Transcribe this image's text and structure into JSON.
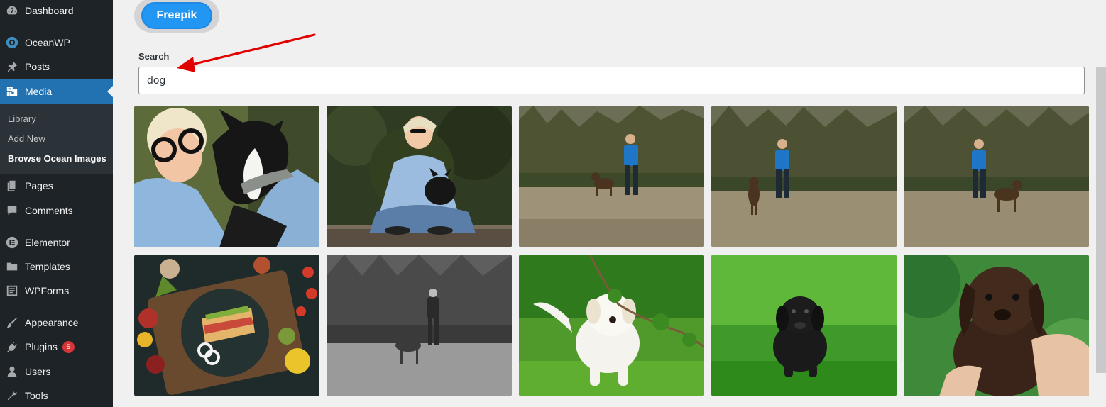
{
  "sidebar": {
    "items": [
      {
        "label": "Dashboard",
        "icon": "dashboard-icon"
      },
      {
        "label": "OceanWP",
        "icon": "oceanwp-icon"
      },
      {
        "label": "Posts",
        "icon": "pin-icon"
      },
      {
        "label": "Media",
        "icon": "media-icon",
        "active": true
      },
      {
        "label": "Pages",
        "icon": "pages-icon"
      },
      {
        "label": "Comments",
        "icon": "comments-icon"
      },
      {
        "label": "Elementor",
        "icon": "elementor-icon"
      },
      {
        "label": "Templates",
        "icon": "folder-icon"
      },
      {
        "label": "WPForms",
        "icon": "forms-icon"
      },
      {
        "label": "Appearance",
        "icon": "brush-icon"
      },
      {
        "label": "Plugins",
        "icon": "plugin-icon",
        "badge": "5"
      },
      {
        "label": "Users",
        "icon": "user-icon"
      },
      {
        "label": "Tools",
        "icon": "wrench-icon"
      }
    ],
    "submenu": [
      {
        "label": "Library"
      },
      {
        "label": "Add New"
      },
      {
        "label": "Browse Ocean Images",
        "current": true
      }
    ]
  },
  "main": {
    "source_button": "Freepik",
    "search_label": "Search",
    "search_value": "dog",
    "results": [
      {
        "name": "woman-with-french-bulldog-closeup"
      },
      {
        "name": "woman-sitting-with-french-bulldog"
      },
      {
        "name": "man-walking-dog-forest-1"
      },
      {
        "name": "man-walking-dog-forest-2"
      },
      {
        "name": "man-walking-dog-forest-3"
      },
      {
        "name": "food-flatlay-sandwich"
      },
      {
        "name": "man-walking-dog-bw"
      },
      {
        "name": "white-puppy-grass"
      },
      {
        "name": "black-puppy-grass"
      },
      {
        "name": "brown-puppy-held"
      }
    ]
  },
  "colors": {
    "sidebar_bg": "#1d2327",
    "active_bg": "#2271b1",
    "freepik_blue": "#2196f3",
    "badge_red": "#d63638",
    "annotation_red": "#e00000"
  }
}
